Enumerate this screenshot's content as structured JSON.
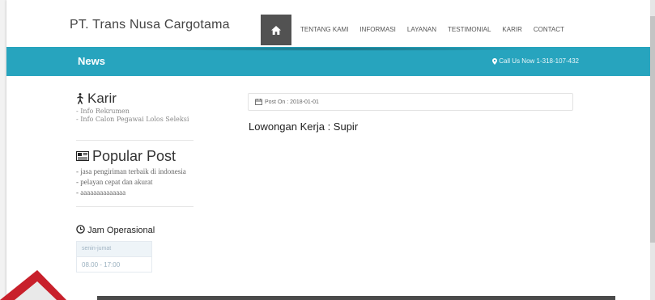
{
  "header": {
    "brand": "PT. Trans Nusa Cargotama",
    "home_icon": "home-icon",
    "nav": [
      "TENTANG KAMI",
      "INFORMASI",
      "LAYANAN",
      "TESTIMONIAL",
      "KARIR",
      "CONTACT"
    ]
  },
  "newsbar": {
    "title": "News",
    "call_us": "Call Us Now 1-318-107-432",
    "color": "#27a4be"
  },
  "sidebar": {
    "karir": {
      "title": "Karir",
      "items": [
        "Info Rekrumen",
        "Info Calon Pegawai Lolos Seleksi"
      ]
    },
    "popular": {
      "title": "Popular Post",
      "items": [
        "jasa pengiriman terbaik di indonesia",
        "pelayan cepat dan akurat",
        "aaaaaaaaaaaaaa"
      ]
    },
    "jam": {
      "title": "Jam Operasional",
      "days": "senin-jumat",
      "hours": "08.00 - 17:00"
    }
  },
  "post": {
    "meta": "Post On : 2018-01-01",
    "title": "Lowongan Kerja : Supir"
  }
}
